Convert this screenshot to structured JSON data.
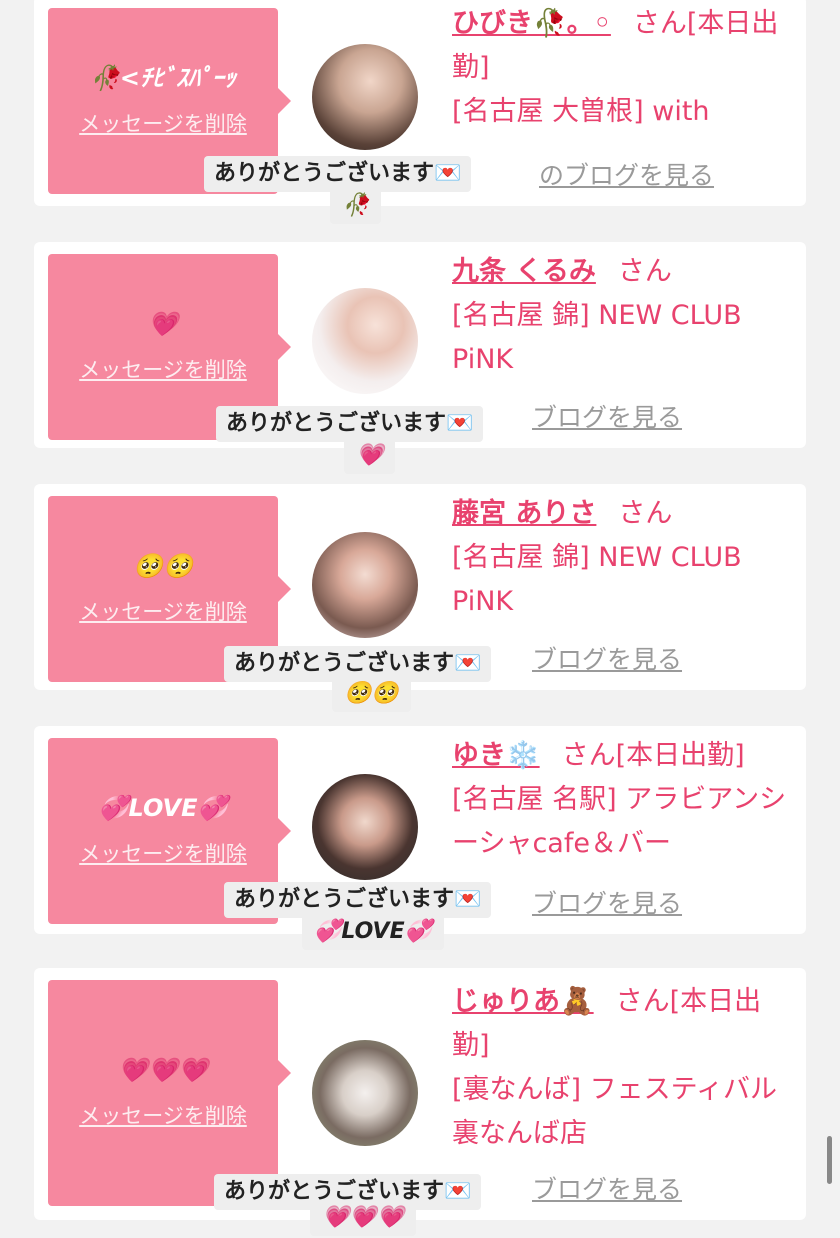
{
  "colors": {
    "accent": "#e8426e",
    "bubble": "#f6889f",
    "background": "#f2f2f2"
  },
  "common": {
    "delete_label": "メッセージを削除",
    "thanks_label": "ありがとうございます💌",
    "san": "さん"
  },
  "items": [
    {
      "name": "ひびき🥀。◦",
      "status": "[本日出勤]",
      "shop": "[名古屋 大曽根] with",
      "message": "🥀<ﾁﾋﾞｽﾊﾟｰｯ",
      "blog_label": "のブログを見る",
      "reply_emoji": "🥀"
    },
    {
      "name": "九条 くるみ",
      "status": "",
      "shop": "[名古屋 錦] NEW CLUB PiNK",
      "message": "💗",
      "blog_label": "ブログを見る",
      "reply_emoji": "💗"
    },
    {
      "name": "藤宮 ありさ",
      "status": "",
      "shop": "[名古屋 錦] NEW CLUB PiNK",
      "message": "🥺🥺",
      "blog_label": "ブログを見る",
      "reply_emoji": "🥺🥺"
    },
    {
      "name": "ゆき❄️",
      "status": "[本日出勤]",
      "shop": "[名古屋 名駅] アラビアンシーシャcafe＆バー",
      "message": "💞LOVE💞",
      "blog_label": "ブログを見る",
      "reply_emoji": "💞LOVE💞"
    },
    {
      "name": "じゅりあ🧸",
      "status": "[本日出勤]",
      "shop": "[裏なんば] フェスティバル裏なんば店",
      "message": "💗💗💗",
      "blog_label": "ブログを見る",
      "reply_emoji": "💗💗💗"
    }
  ]
}
